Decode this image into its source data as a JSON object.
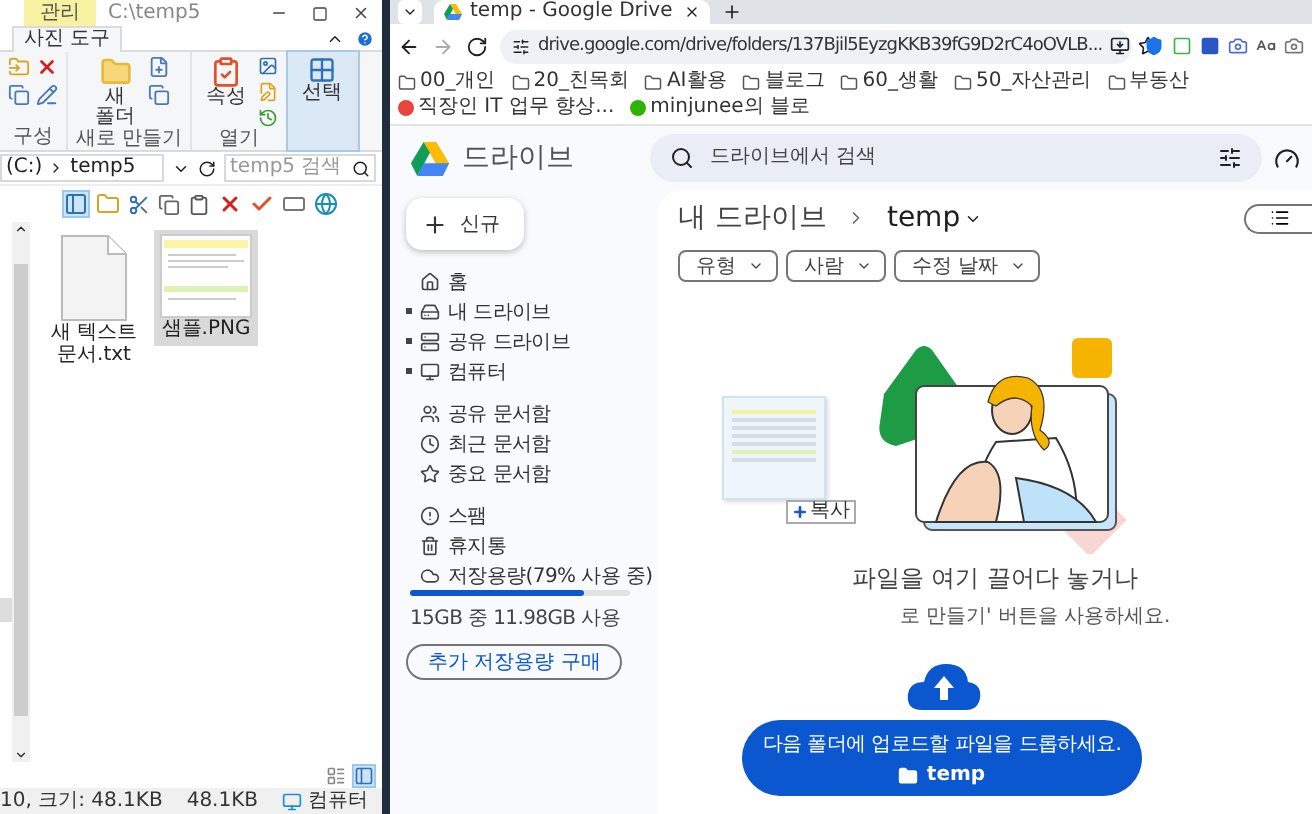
{
  "explorer": {
    "context_tab": "관리",
    "title": "C:\\temp5",
    "ribbon_tab": "사진 도구",
    "ribbon_groups": [
      {
        "kind": "organize",
        "label": "구성"
      },
      {
        "kind": "new",
        "label": "새로 만들기",
        "button": "새 폴더"
      },
      {
        "kind": "open",
        "label": "열기",
        "button": "속성"
      },
      {
        "kind": "select",
        "button": "선택"
      }
    ],
    "address": {
      "drive": "(C:)",
      "folder": "temp5"
    },
    "search_placeholder": "temp5 검색",
    "files": [
      {
        "name": "새 텍스트 문서.txt",
        "kind": "text",
        "selected": false
      },
      {
        "name": "샘플.PNG",
        "kind": "image",
        "selected": true
      }
    ],
    "status": [
      {
        "text": "10, 크기: 48.1KB",
        "kind": "plain"
      },
      {
        "text": "48.1KB",
        "kind": "plain"
      },
      {
        "text": "컴퓨터",
        "kind": "zone"
      }
    ]
  },
  "browser": {
    "tab_title": "temp - Google Drive",
    "url": "drive.google.com/drive/folders/137Bjil5EyzgKKB39fG9D2rC4oOVLB...",
    "bookmarks": [
      {
        "label": "00_개인",
        "kind": "folder"
      },
      {
        "label": "20_친목회",
        "kind": "folder"
      },
      {
        "label": "AI활용",
        "kind": "folder"
      },
      {
        "label": "블로그",
        "kind": "folder"
      },
      {
        "label": "60_생활",
        "kind": "folder"
      },
      {
        "label": "50_자산관리",
        "kind": "folder"
      },
      {
        "label": "부동산",
        "kind": "folder"
      },
      {
        "label": "직장인 IT 업무 향상...",
        "kind": "site",
        "color": "#e8453c"
      },
      {
        "label": "minjunee의 블로",
        "kind": "site",
        "color": "#2db400"
      }
    ]
  },
  "drive": {
    "brand": "드라이브",
    "search_placeholder": "드라이브에서 검색",
    "new_button": "신규",
    "nav_sections": [
      [
        {
          "label": "홈",
          "kind": "home",
          "expandable": false,
          "selected": false
        },
        {
          "label": "내 드라이브",
          "kind": "mydrive",
          "expandable": true,
          "selected": false
        },
        {
          "label": "공유 드라이브",
          "kind": "shared-drive",
          "expandable": true,
          "selected": false
        },
        {
          "label": "컴퓨터",
          "kind": "computer",
          "expandable": true,
          "selected": false
        }
      ],
      [
        {
          "label": "공유 문서함",
          "kind": "shared",
          "expandable": false,
          "selected": false
        },
        {
          "label": "최근 문서함",
          "kind": "recent",
          "expandable": false,
          "selected": false
        },
        {
          "label": "중요 문서함",
          "kind": "starred",
          "expandable": false,
          "selected": false
        }
      ],
      [
        {
          "label": "스팸",
          "kind": "spam",
          "expandable": false,
          "selected": false
        },
        {
          "label": "휴지통",
          "kind": "trash",
          "expandable": false,
          "selected": false
        },
        {
          "label": "저장용량(79% 사용 중)",
          "kind": "storage",
          "expandable": false,
          "selected": false
        }
      ]
    ],
    "storage": {
      "level": 0.79,
      "usage": "15GB 중 11.98GB 사용",
      "buy_button": "추가 저장용량 구매"
    },
    "breadcrumb": [
      "내 드라이브",
      "temp"
    ],
    "filters": [
      "유형",
      "사람",
      "수정 날짜"
    ],
    "drop": {
      "title": "파일을 여기 끌어다 놓거나",
      "subtitle": "로 만들기' 버튼을 사용하세요.",
      "drag_badge": "복사",
      "banner_text": "다음 폴더에 업로드할 파일을 드롭하세요.",
      "banner_folder": "temp"
    }
  }
}
